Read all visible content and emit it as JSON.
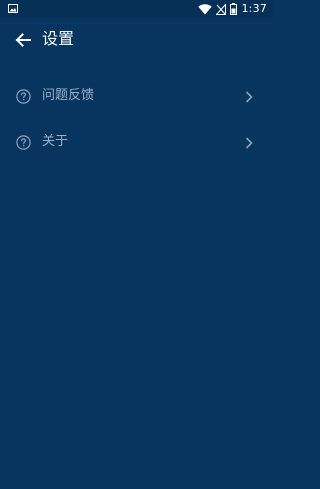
{
  "status_bar": {
    "time": "1:37",
    "icons": [
      "gallery-icon",
      "wifi-icon",
      "no-signal-icon",
      "battery-icon"
    ]
  },
  "app_bar": {
    "back_icon": "arrow-left-icon",
    "title": "设置"
  },
  "settings": {
    "items": [
      {
        "icon": "help-circle-icon",
        "label": "问题反馈",
        "chevron": "chevron-right-icon"
      },
      {
        "icon": "help-circle-icon",
        "label": "关于",
        "chevron": "chevron-right-icon"
      }
    ]
  },
  "colors": {
    "background": "#07355f",
    "status_bar": "#063056",
    "title": "#ffffff",
    "item_text": "#9bb0c5",
    "icon": "#8aa3bb"
  }
}
